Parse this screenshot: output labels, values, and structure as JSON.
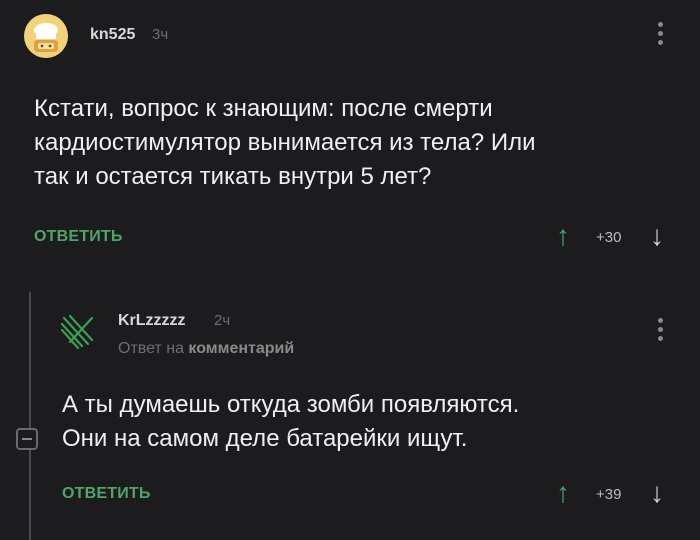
{
  "comment": {
    "username": "kn525",
    "time": "3ч",
    "body_lines": [
      "Кстати, вопрос к знающим: после смерти",
      "кардиостимулятор вынимается из тела? Или",
      "так и остается тикать внутри 5 лет?"
    ],
    "reply_label": "ОТВЕТИТЬ",
    "score": "+30",
    "avatar_icon": "chef-avatar-icon",
    "upvote_icon": "arrow-up-icon",
    "downvote_icon": "arrow-down-icon"
  },
  "reply": {
    "username": "KrLzzzzz",
    "time": "2ч",
    "reply_to_prefix": "Ответ на",
    "reply_to_target": "комментарий",
    "body_lines": [
      "А ты думаешь откуда зомби появляются.",
      "Они на самом деле батарейки ищут."
    ],
    "reply_label": "ОТВЕТИТЬ",
    "score": "+39",
    "avatar_icon": "striped-avatar-icon"
  },
  "colors": {
    "background": "#1c1c1e",
    "accent": "#4fa46a",
    "text": "#f0f0f0",
    "muted": "#6f6f6f"
  }
}
